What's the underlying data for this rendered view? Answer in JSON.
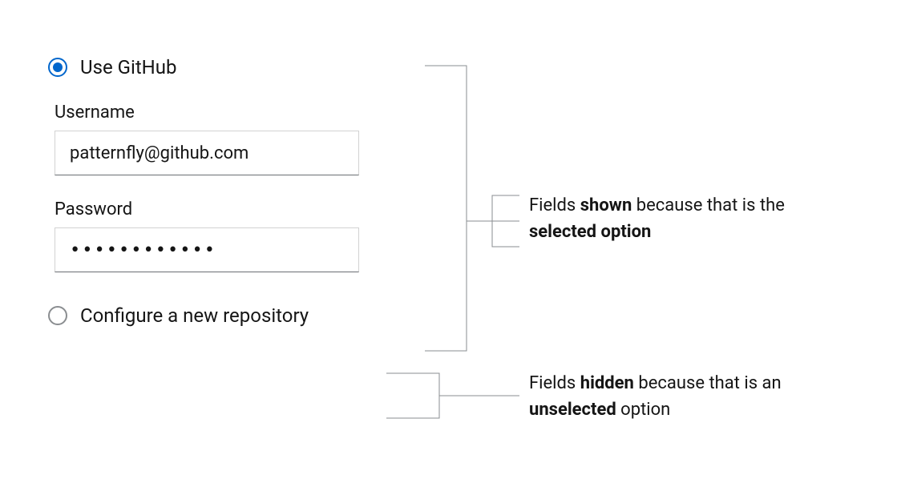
{
  "options": {
    "use_github": {
      "label": "Use GitHub",
      "selected": true
    },
    "configure_repo": {
      "label": "Configure a new repository",
      "selected": false
    }
  },
  "fields": {
    "username": {
      "label": "Username",
      "value": "patternfly@github.com"
    },
    "password": {
      "label": "Password",
      "value": "************"
    }
  },
  "annotations": {
    "shown": {
      "prefix": "Fields ",
      "bold1": "shown",
      "mid": " because that is the ",
      "bold2": "selected option"
    },
    "hidden": {
      "prefix": "Fields ",
      "bold1": "hidden",
      "mid": " because that is an ",
      "bold2": "unselected",
      "suffix": " option"
    }
  }
}
